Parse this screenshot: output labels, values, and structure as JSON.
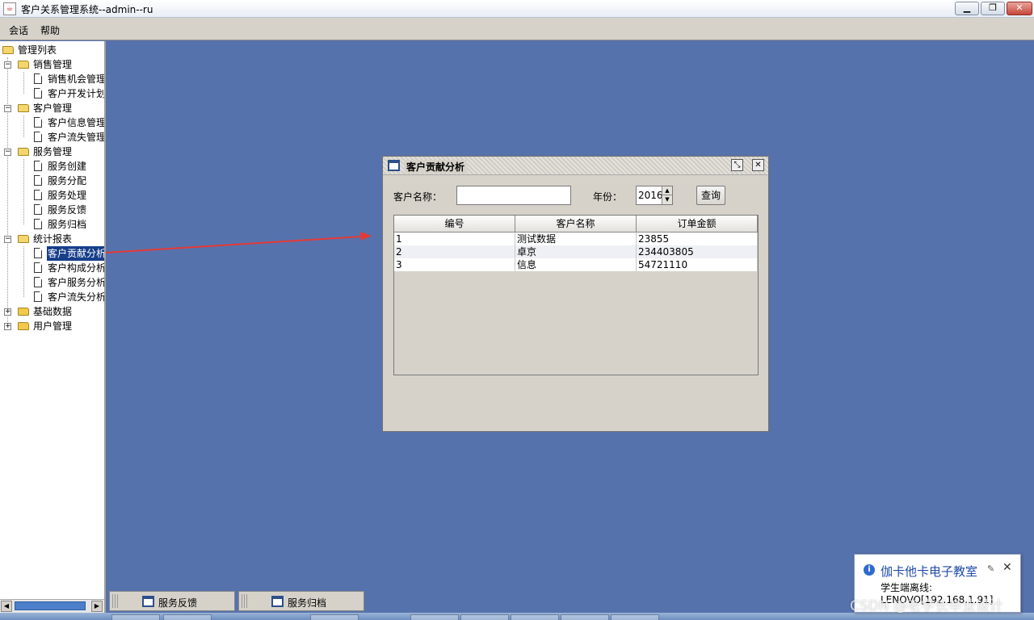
{
  "window": {
    "title": "客户关系管理系统--admin--ru",
    "icon": "java-cup-icon",
    "minimize_label": "▁",
    "restore_label": "❐",
    "close_label": "✕"
  },
  "menubar": {
    "items": [
      "会话",
      "帮助"
    ]
  },
  "tree": {
    "root": "管理列表",
    "groups": [
      {
        "label": "销售管理",
        "expanded": true,
        "children": [
          "销售机会管理",
          "客户开发计划"
        ]
      },
      {
        "label": "客户管理",
        "expanded": true,
        "children": [
          "客户信息管理",
          "客户流失管理"
        ]
      },
      {
        "label": "服务管理",
        "expanded": true,
        "children": [
          "服务创建",
          "服务分配",
          "服务处理",
          "服务反馈",
          "服务归档"
        ]
      },
      {
        "label": "统计报表",
        "expanded": true,
        "children": [
          "客户贡献分析",
          "客户构成分析",
          "客户服务分析",
          "客户流失分析"
        ]
      },
      {
        "label": "基础数据",
        "expanded": false,
        "children": []
      },
      {
        "label": "用户管理",
        "expanded": false,
        "children": []
      }
    ],
    "selected": "客户贡献分析",
    "expand_symbol": "+",
    "collapse_symbol": "−"
  },
  "internal_frame": {
    "title": "客户贡献分析",
    "restore_label": "⤡",
    "close_label": "✕",
    "customer_name_label": "客户名称：",
    "customer_name_value": "",
    "year_label": "年份：",
    "year_value": "2016",
    "spinner_up": "▲",
    "spinner_down": "▼",
    "query_label": "查询",
    "table": {
      "columns": [
        "编号",
        "客户名称",
        "订单金额"
      ],
      "rows": [
        [
          "1",
          "测试数据",
          "23855"
        ],
        [
          "2",
          "卓京",
          "234403805"
        ],
        [
          "3",
          "信息",
          "54721110"
        ]
      ]
    }
  },
  "scrollbar": {
    "left": "◀",
    "right": "▶"
  },
  "minimized_frames": [
    "服务反馈",
    "服务归档"
  ],
  "notification": {
    "title": "伽卡他卡电子教室",
    "line1": "学生端离线:",
    "line2": "LENOVO[192.168.1.91]",
    "pin": "✎",
    "close": "✕"
  },
  "watermark": "CSDN @老学长毕业设计",
  "colors": {
    "desktop": "#5672AC",
    "selection": "#163E8A",
    "annotation_arrow": "#E53935"
  }
}
